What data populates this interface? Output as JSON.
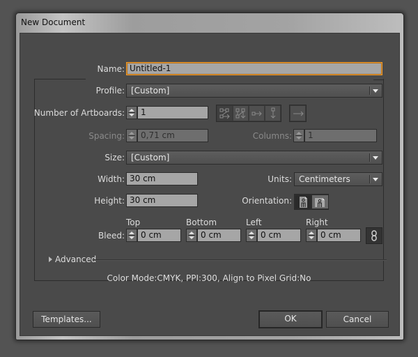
{
  "window": {
    "title": "New Document"
  },
  "name": {
    "label": "Name:",
    "value": "Untitled-1"
  },
  "profile": {
    "label": "Profile:",
    "value": "[Custom]"
  },
  "artboards": {
    "label": "Number of Artboards:",
    "value": "1",
    "layout_icons": [
      "grid-by-row-icon",
      "grid-by-column-icon",
      "arrange-by-row-icon",
      "arrange-by-column-icon",
      "left-to-right-layout-icon"
    ]
  },
  "spacing": {
    "label": "Spacing:",
    "value": "0,71 cm",
    "disabled": true
  },
  "columns": {
    "label": "Columns:",
    "value": "1",
    "disabled": true
  },
  "size": {
    "label": "Size:",
    "value": "[Custom]"
  },
  "width": {
    "label": "Width:",
    "value": "30 cm"
  },
  "units": {
    "label": "Units:",
    "value": "Centimeters"
  },
  "height": {
    "label": "Height:",
    "value": "30 cm"
  },
  "orientation": {
    "label": "Orientation:",
    "selected": "portrait"
  },
  "bleed": {
    "label": "Bleed:",
    "top": {
      "label": "Top",
      "value": "0 cm"
    },
    "bottom": {
      "label": "Bottom",
      "value": "0 cm"
    },
    "left": {
      "label": "Left",
      "value": "0 cm"
    },
    "right": {
      "label": "Right",
      "value": "0 cm"
    }
  },
  "advanced": {
    "label": "Advanced",
    "expanded": false
  },
  "summary": "Color Mode:CMYK, PPI:300, Align to Pixel Grid:No",
  "buttons": {
    "templates": "Templates...",
    "ok": "OK",
    "cancel": "Cancel"
  },
  "colors": {
    "focus": "#f09b2c",
    "panel": "#4a4a4a",
    "field": "#a6a6a6"
  }
}
